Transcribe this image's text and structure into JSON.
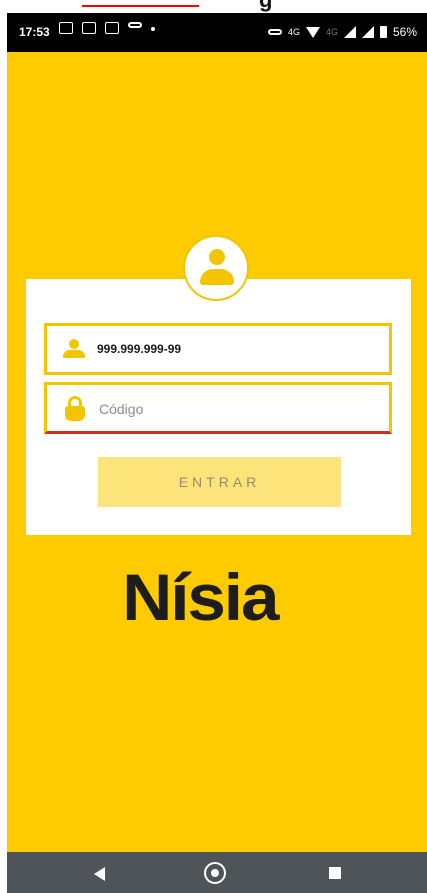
{
  "top_header": {
    "bold_text": "g"
  },
  "status_bar": {
    "time": "17:53",
    "lte_label_1": "4G",
    "lte_label_2": "4G",
    "battery": "56%"
  },
  "login": {
    "cpf_value": "999.999.999-99",
    "code_placeholder": "Código",
    "submit_label": "ENTRAR"
  },
  "brand": {
    "logo_text": "Nísia"
  },
  "colors": {
    "background": "#fdcb00",
    "card": "#ffffff",
    "accent": "#f3c400",
    "button": "#fde47a",
    "error_underline": "#d82a1e",
    "nav_bar": "#4e5457"
  },
  "icons": {
    "avatar": "user-icon",
    "cpf_field": "user-icon",
    "code_field": "lock-icon",
    "nav": [
      "back-icon",
      "home-icon",
      "recents-icon"
    ]
  }
}
